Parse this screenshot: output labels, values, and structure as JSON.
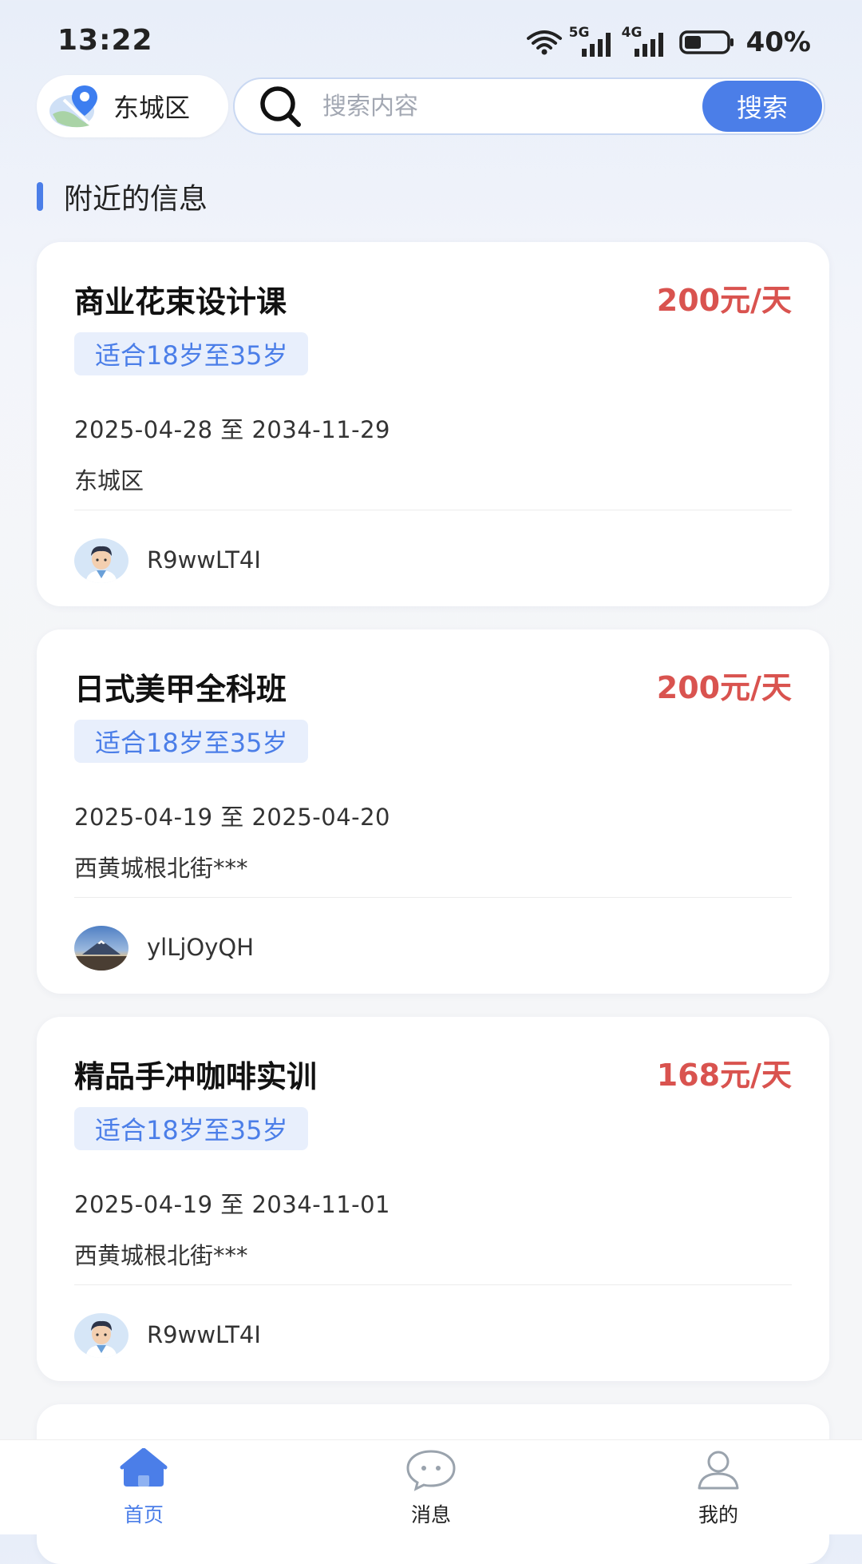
{
  "status_bar": {
    "time": "13:22",
    "network_1": "5G",
    "network_2": "4G",
    "battery": "40%",
    "battery_level": 0.4
  },
  "header": {
    "location_label": "东城区",
    "search_placeholder": "搜索内容",
    "search_button_label": "搜索"
  },
  "section": {
    "title": "附近的信息"
  },
  "cards": [
    {
      "title": "商业花束设计课",
      "price": "200元/天",
      "age_tag": "适合18岁至35岁",
      "dates": "2025-04-28 至 2034-11-29",
      "location": "东城区",
      "username": "R9wwLT4I",
      "avatar": "cartoon-man-avatar"
    },
    {
      "title": "日式美甲全科班",
      "price": "200元/天",
      "age_tag": "适合18岁至35岁",
      "dates": "2025-04-19 至 2025-04-20",
      "location": "西黄城根北街***",
      "username": "ylLjOyQH",
      "avatar": "mountain-landscape-avatar"
    },
    {
      "title": "精品手冲咖啡实训",
      "price": "168元/天",
      "age_tag": "适合18岁至35岁",
      "dates": "2025-04-19 至 2034-11-01",
      "location": "西黄城根北街***",
      "username": "R9wwLT4I",
      "avatar": "cartoon-man-avatar"
    }
  ],
  "tab_bar": {
    "tabs": [
      {
        "label": "首页",
        "icon": "home-icon",
        "active": true
      },
      {
        "label": "消息",
        "icon": "message-icon",
        "active": false
      },
      {
        "label": "我的",
        "icon": "profile-icon",
        "active": false
      }
    ]
  },
  "colors": {
    "accent": "#4b7ee8",
    "price": "#d9534f",
    "badge_bg": "#e8effc"
  }
}
